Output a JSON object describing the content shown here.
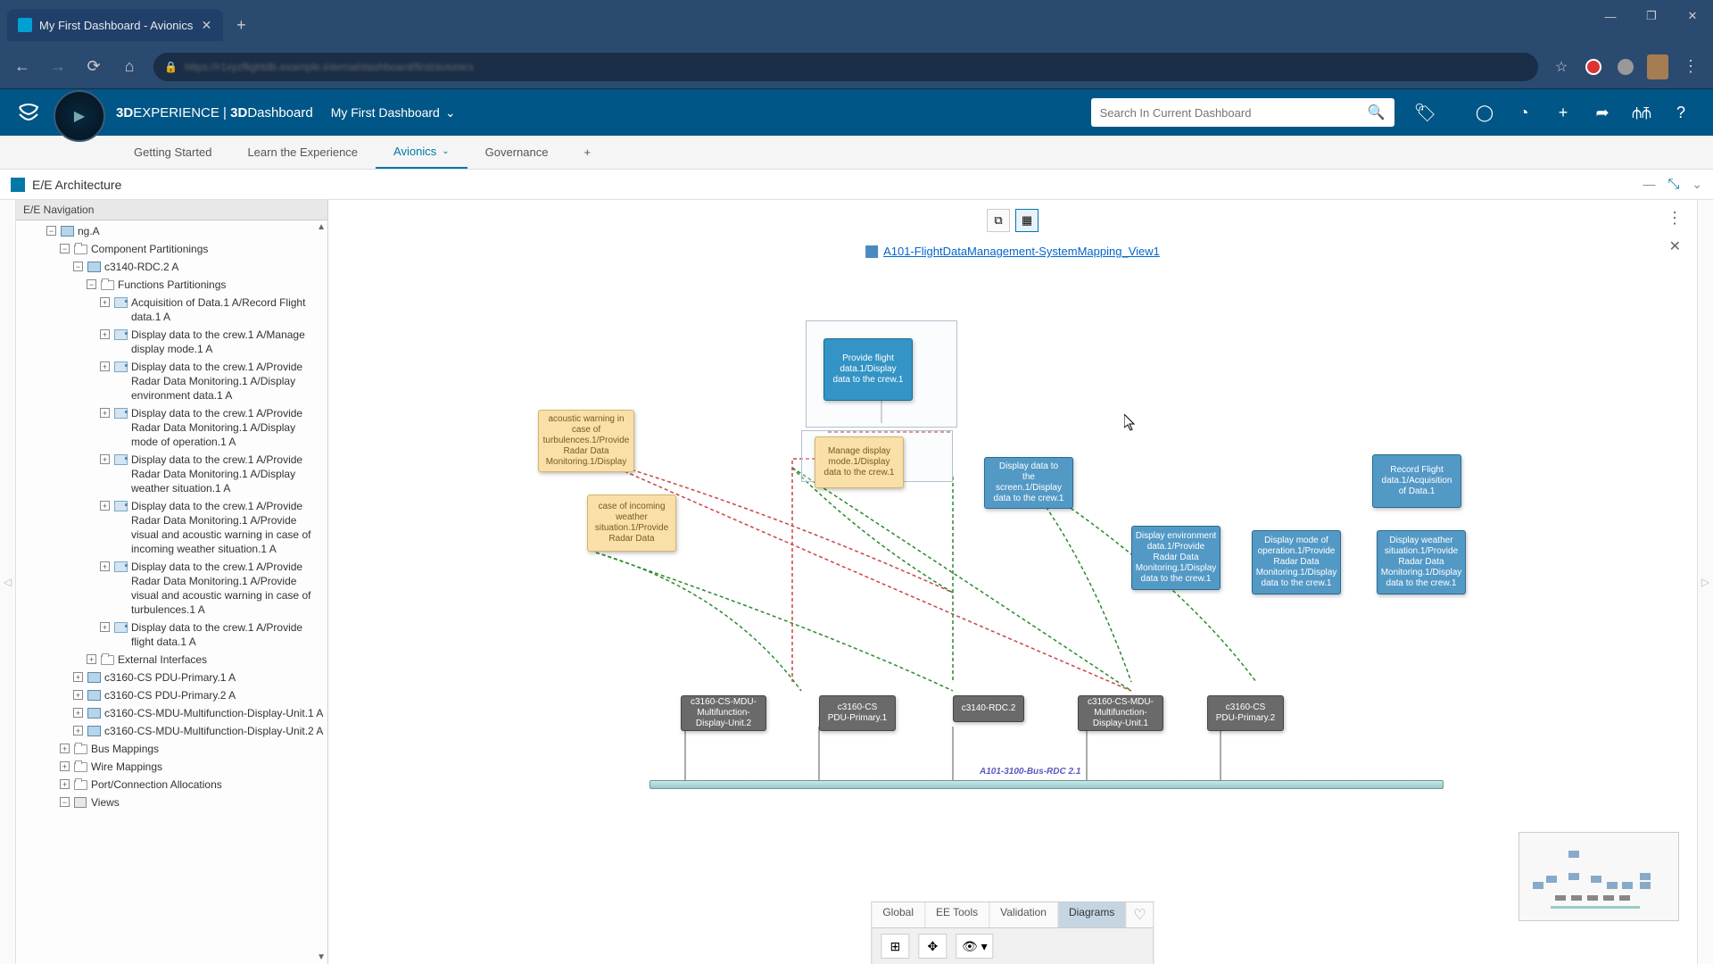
{
  "browser": {
    "tab_title": "My First Dashboard - Avionics",
    "url_blur": "https://r1xyzflightdb.example.internal/dashboard/first/avionics"
  },
  "app_header": {
    "brand_bold": "3D",
    "brand_rest": "EXPERIENCE",
    "brand_sep": " | ",
    "brand_app_bold": "3D",
    "brand_app_rest": "Dashboard",
    "breadcrumb": "My First Dashboard",
    "search_placeholder": "Search In Current Dashboard"
  },
  "tabs": {
    "t1": "Getting Started",
    "t2": "Learn the Experience",
    "t3": "Avionics",
    "t4": "Governance"
  },
  "widget_title": "E/E Architecture",
  "tree": {
    "header": "E/E Navigation",
    "n0": "ng.A",
    "n1": "Component Partitionings",
    "n2": "c3140-RDC.2 A",
    "n3": "Functions Partitionings",
    "n4": "Acquisition of Data.1 A/Record Flight data.1 A",
    "n5": "Display data to the crew.1 A/Manage display mode.1 A",
    "n6": "Display data to the crew.1 A/Provide Radar Data Monitoring.1 A/Display environment data.1 A",
    "n7": "Display data to the crew.1 A/Provide Radar Data Monitoring.1 A/Display mode of operation.1 A",
    "n8": "Display data to the crew.1 A/Provide Radar Data Monitoring.1 A/Display weather situation.1 A",
    "n9": "Display data to the crew.1 A/Provide Radar Data Monitoring.1 A/Provide visual and acoustic warning in case of incoming weather situation.1 A",
    "n10": "Display data to the crew.1 A/Provide Radar Data Monitoring.1 A/Provide visual and acoustic warning in case of turbulences.1 A",
    "n11": "Display data to the crew.1 A/Provide flight data.1 A",
    "n12": "External Interfaces",
    "n13": "c3160-CS PDU-Primary.1 A",
    "n14": "c3160-CS PDU-Primary.2 A",
    "n15": "c3160-CS-MDU-Multifunction-Display-Unit.1 A",
    "n16": "c3160-CS-MDU-Multifunction-Display-Unit.2 A",
    "n17": "Bus Mappings",
    "n18": "Wire Mappings",
    "n19": "Port/Connection Allocations",
    "n20": "Views"
  },
  "canvas": {
    "title": "A101-FlightDataManagement-SystemMapping_View1",
    "bus_label": "A101-3100-Bus-RDC 2.1",
    "nodes": {
      "b1": "Provide flight data.1/Display data to the crew.1",
      "y1": "acoustic warning in case of turbulences.1/Provide Radar Data Monitoring.1/Display",
      "y2": "Manage display mode.1/Display data to the crew.1",
      "y3": "case of incoming weather situation.1/Provide Radar Data",
      "b2": "Display data to the screen.1/Display data to the crew.1",
      "b3": "Record Flight data.1/Acquisition of Data.1",
      "b4": "Display environment data.1/Provide Radar Data Monitoring.1/Display data to the crew.1",
      "b5": "Display mode of operation.1/Provide Radar Data Monitoring.1/Display data to the crew.1",
      "b6": "Display weather situation.1/Provide Radar Data Monitoring.1/Display data to the crew.1",
      "g1": "c3160-CS-MDU-Multifunction-Display-Unit.2",
      "g2": "c3160-CS PDU-Primary.1",
      "g3": "c3140-RDC.2",
      "g4": "c3160-CS-MDU-Multifunction-Display-Unit.1",
      "g5": "c3160-CS PDU-Primary.2"
    }
  },
  "bottom_bar": {
    "t1": "Global",
    "t2": "EE Tools",
    "t3": "Validation",
    "t4": "Diagrams"
  }
}
